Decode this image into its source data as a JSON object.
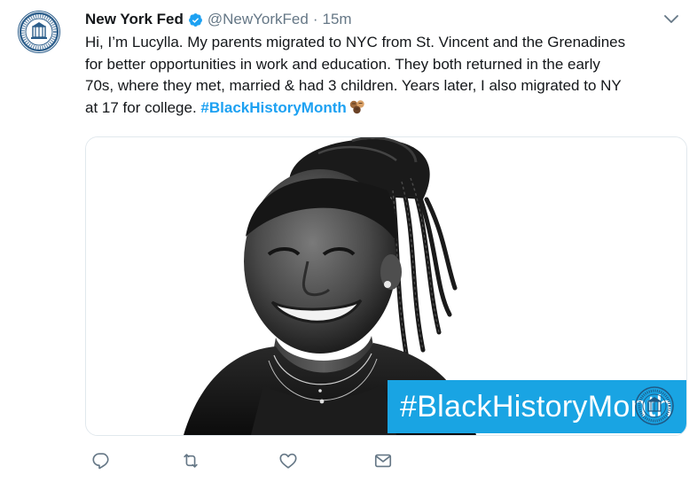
{
  "tweet": {
    "display_name": "New York Fed",
    "handle": "@NewYorkFed",
    "separator": "·",
    "timestamp": "15m",
    "text_lines": [
      "Hi, I’m Lucylla. My parents migrated to NYC from St. Vincent and the Grenadines",
      "for better opportunities in work and education. They both returned in the early",
      "70s, where they met, married & had 3 children. Years later, I also migrated to NY"
    ],
    "text_last_line": "at 17 for college. ",
    "hashtag": "#BlackHistoryMonth",
    "emoji": "fist-bumps-emoji"
  },
  "media": {
    "banner_text": "#BlackHistoryMonth",
    "banner_color": "#19a4e3"
  },
  "icons": {
    "avatar": "federal-reserve-seal-icon",
    "verified": "verified-badge-icon",
    "menu": "chevron-down-icon",
    "reply": "reply-icon",
    "retweet": "retweet-icon",
    "like": "heart-icon",
    "dm": "envelope-icon"
  },
  "colors": {
    "link": "#1da1f2",
    "secondary_text": "#657786",
    "primary_text": "#14171a",
    "border": "#e1e8ed"
  }
}
